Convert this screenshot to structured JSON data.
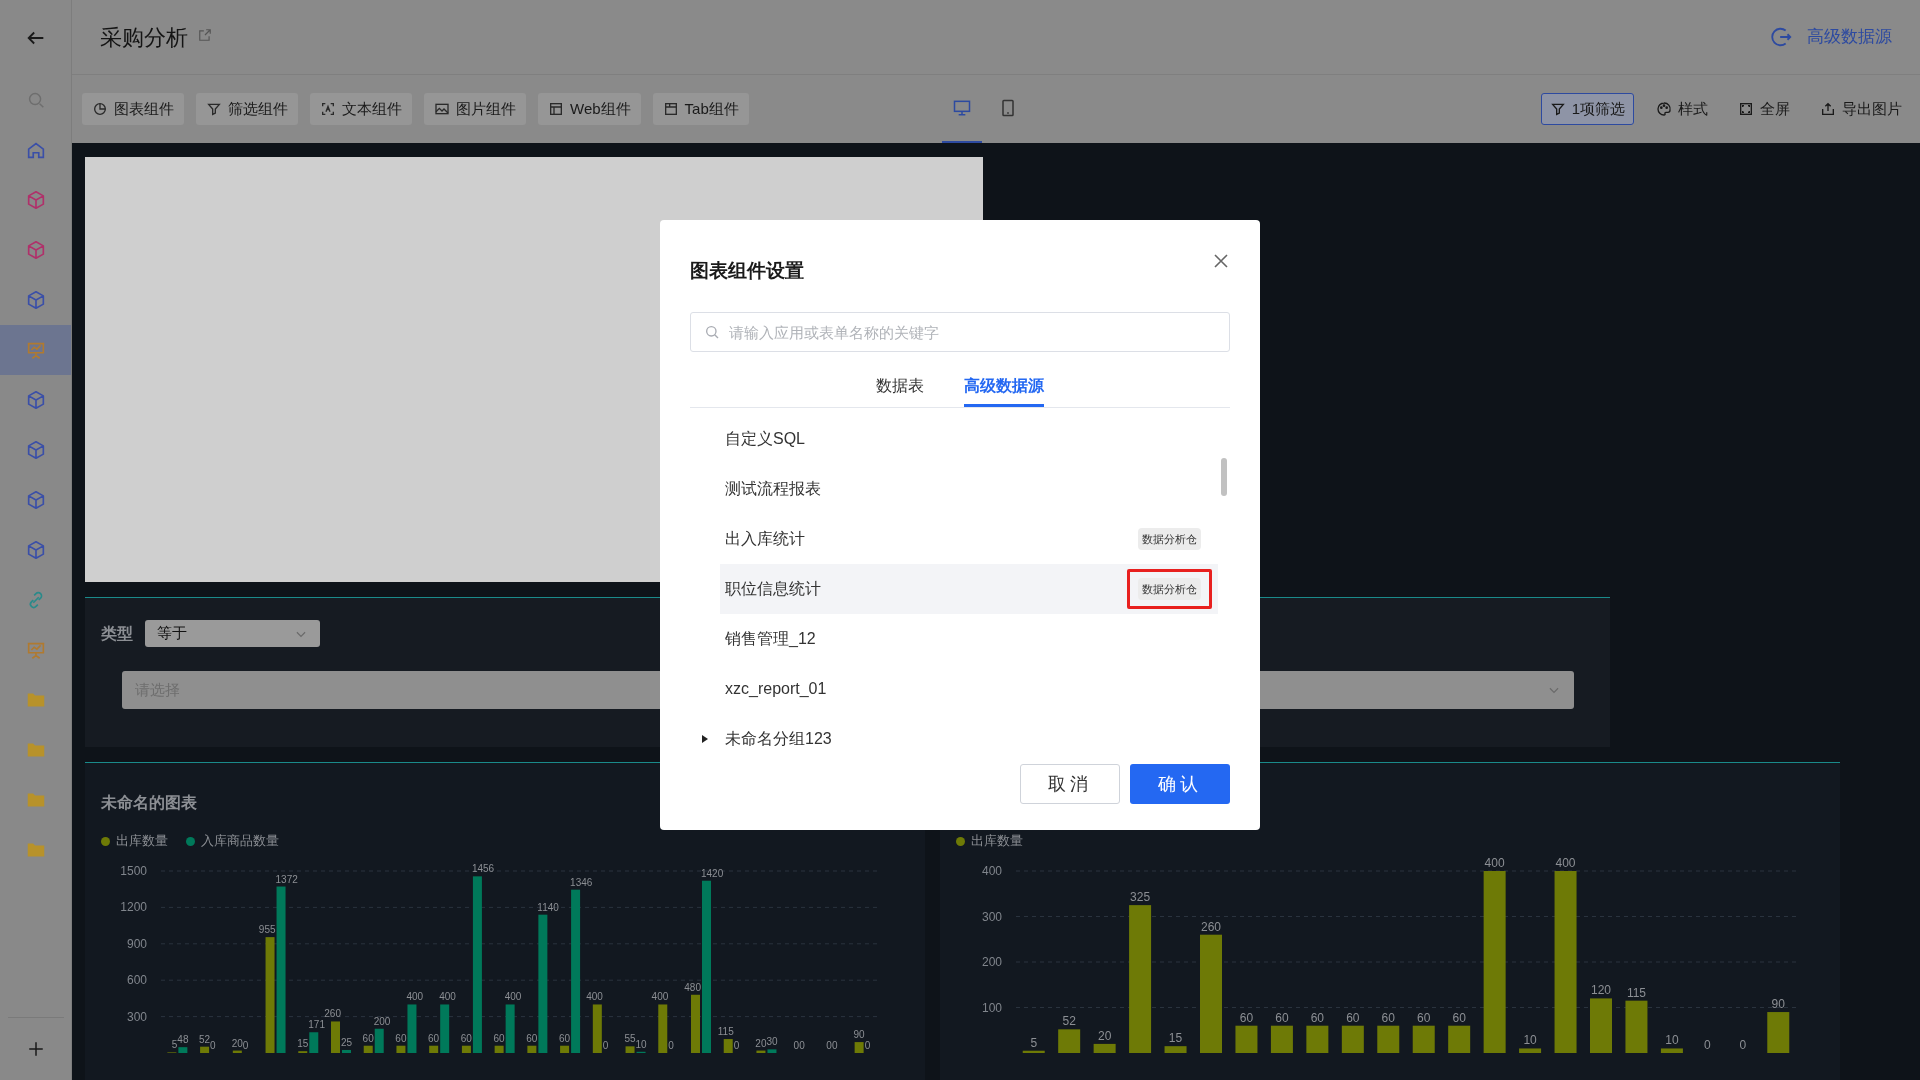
{
  "header": {
    "title": "采购分析",
    "datasource_link": "高级数据源"
  },
  "sidebar": {
    "items": [
      {
        "kind": "search",
        "color": "#6e6e6e",
        "selected": false
      },
      {
        "kind": "home",
        "color": "#3a4fa8",
        "selected": false
      },
      {
        "kind": "cube",
        "color": "#b0306a",
        "selected": false
      },
      {
        "kind": "cube",
        "color": "#b0306a",
        "selected": false
      },
      {
        "kind": "cube",
        "color": "#3a4fa8",
        "selected": false
      },
      {
        "kind": "board",
        "color": "#b07a30",
        "selected": true
      },
      {
        "kind": "cube",
        "color": "#3a4fa8",
        "selected": false
      },
      {
        "kind": "cube",
        "color": "#3a4fa8",
        "selected": false
      },
      {
        "kind": "cube",
        "color": "#3a4fa8",
        "selected": false
      },
      {
        "kind": "cube",
        "color": "#3a4fa8",
        "selected": false
      },
      {
        "kind": "link",
        "color": "#2a8a8a",
        "selected": false
      },
      {
        "kind": "board",
        "color": "#b07a30",
        "selected": false
      },
      {
        "kind": "folder",
        "color": "#b8922a",
        "selected": false
      },
      {
        "kind": "folder",
        "color": "#b8922a",
        "selected": false
      },
      {
        "kind": "folder",
        "color": "#b8922a",
        "selected": false
      },
      {
        "kind": "folder",
        "color": "#b8922a",
        "selected": false
      }
    ]
  },
  "toolbar": {
    "components": [
      {
        "kind": "chart",
        "label": "图表组件"
      },
      {
        "kind": "filter",
        "label": "筛选组件"
      },
      {
        "kind": "text",
        "label": "文本组件"
      },
      {
        "kind": "image",
        "label": "图片组件"
      },
      {
        "kind": "web",
        "label": "Web组件"
      },
      {
        "kind": "tab",
        "label": "Tab组件"
      }
    ],
    "devices": [
      {
        "kind": "desktop",
        "selected": true
      },
      {
        "kind": "mobile",
        "selected": false
      }
    ],
    "actions": [
      {
        "kind": "filter",
        "label": "1项筛选",
        "active": true
      },
      {
        "kind": "style",
        "label": "样式",
        "active": false
      },
      {
        "kind": "fullscreen",
        "label": "全屏",
        "active": false
      },
      {
        "kind": "export",
        "label": "导出图片",
        "active": false
      }
    ]
  },
  "canvas": {
    "filter_panel": {
      "label": "类型",
      "operator": "等于",
      "placeholder": "请选择"
    },
    "charts": [
      {
        "title": "未命名的图表",
        "chart_data": {
          "type": "bar",
          "grid": true,
          "ylim": [
            0,
            1500
          ],
          "yticks": [
            300,
            600,
            900,
            1200,
            1500
          ],
          "data_labels": true,
          "series": [
            {
              "name": "出库数量",
              "color": "#6e7a06",
              "values": [
                5,
                52,
                20,
                955,
                15,
                260,
                60,
                60,
                60,
                60,
                60,
                60,
                60,
                400,
                55,
                400,
                480,
                115,
                20,
                0,
                0,
                90
              ]
            },
            {
              "name": "入库商品数量",
              "color": "#00795a",
              "values": [
                48,
                0,
                0,
                1372,
                171,
                25,
                200,
                400,
                400,
                1456,
                400,
                1140,
                1346,
                0,
                10,
                0,
                1420,
                0,
                30,
                0,
                0,
                0
              ]
            }
          ]
        }
      },
      {
        "chart_data": {
          "type": "bar",
          "grid": true,
          "ylim": [
            0,
            400
          ],
          "yticks": [
            100,
            200,
            300,
            400
          ],
          "data_labels": true,
          "series": [
            {
              "name": "出库数量",
              "color": "#6e7a06",
              "values": [
                5,
                52,
                20,
                325,
                15,
                260,
                60,
                60,
                60,
                60,
                60,
                60,
                60,
                400,
                10,
                400,
                120,
                115,
                10,
                0,
                0,
                90
              ]
            }
          ]
        }
      }
    ]
  },
  "dialog": {
    "title": "图表组件设置",
    "search_placeholder": "请输入应用或表单名称的关键字",
    "tabs": [
      {
        "label": "数据表",
        "selected": false
      },
      {
        "label": "高级数据源",
        "selected": true
      }
    ],
    "items": [
      {
        "kind": "item",
        "label": "自定义SQL",
        "selected": false
      },
      {
        "kind": "item",
        "label": "测试流程报表",
        "selected": false
      },
      {
        "kind": "item",
        "label": "出入库统计",
        "tag": "数据分析仓",
        "selected": false,
        "annotated": false
      },
      {
        "kind": "item",
        "label": "职位信息统计",
        "tag": "数据分析仓",
        "selected": true,
        "annotated": true
      },
      {
        "kind": "item",
        "label": "销售管理_12",
        "selected": false
      },
      {
        "kind": "item",
        "label": "xzc_report_01",
        "selected": false
      },
      {
        "kind": "group",
        "label": "未命名分组123",
        "expanded": false
      }
    ],
    "buttons": [
      {
        "kind": "secondary",
        "label": "取消"
      },
      {
        "kind": "primary",
        "label": "确认"
      }
    ]
  }
}
